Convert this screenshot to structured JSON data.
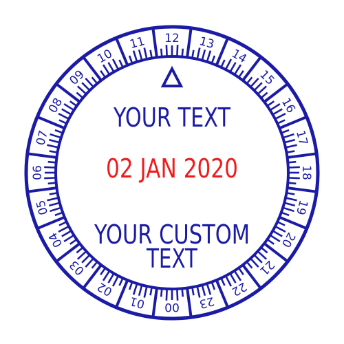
{
  "stamp": {
    "top_text": "YOUR TEXT",
    "date_text": "02 JAN 2020",
    "bottom_text_line1": "YOUR CUSTOM",
    "bottom_text_line2": "TEXT",
    "hour_labels": [
      "00",
      "01",
      "02",
      "03",
      "04",
      "05",
      "06",
      "07",
      "08",
      "09",
      "10",
      "11",
      "12",
      "13",
      "14",
      "15",
      "16",
      "17",
      "18",
      "19",
      "20",
      "21",
      "22",
      "23"
    ],
    "indicator_icon": "triangle-outline-icon",
    "colors": {
      "ink": "#1b1ba6",
      "date": "#ee1c1c",
      "background": "#ffffff"
    }
  }
}
